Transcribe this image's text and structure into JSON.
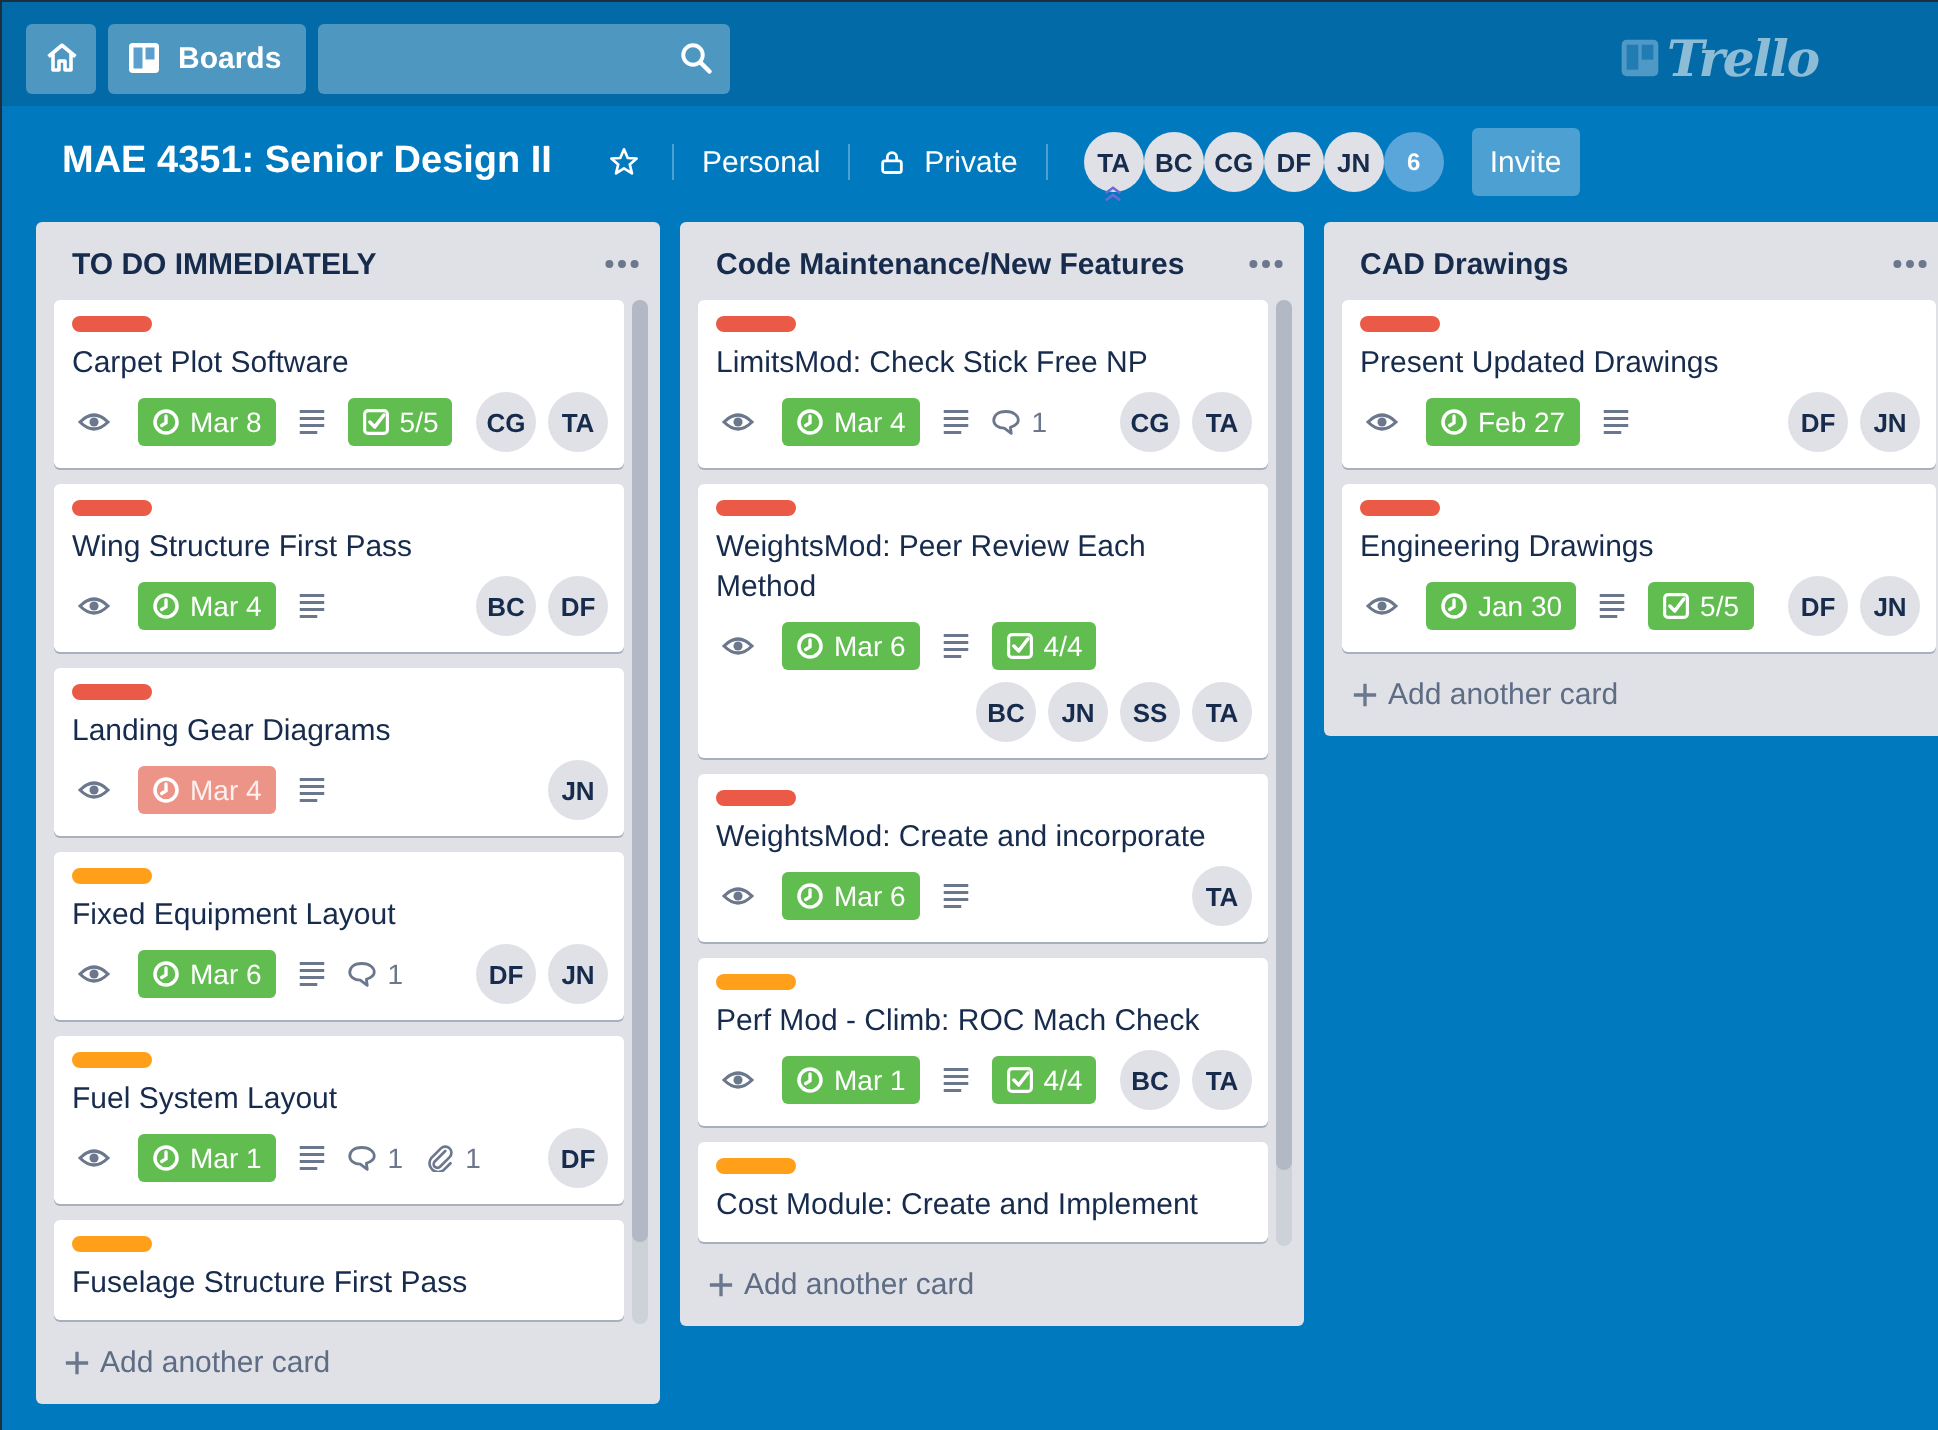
{
  "header": {
    "boards_button": "Boards",
    "logo_text": "Trello"
  },
  "board": {
    "title": "MAE 4351: Senior Design II",
    "starred": false,
    "team": "Personal",
    "visibility": "Private",
    "members": [
      {
        "initials": "TA",
        "admin": true
      },
      {
        "initials": "BC",
        "admin": false
      },
      {
        "initials": "CG",
        "admin": false
      },
      {
        "initials": "DF",
        "admin": false
      },
      {
        "initials": "JN",
        "admin": false
      }
    ],
    "more_members": "6",
    "invite_button": "Invite"
  },
  "lists": [
    {
      "title": "TO DO IMMEDIATELY",
      "scrollbar": true,
      "add_card": "Add another card",
      "cards": [
        {
          "label": {
            "color": "#eb5a46"
          },
          "title": "Carpet Plot Software",
          "watching": true,
          "due": {
            "text": "Mar 8",
            "overdue": false
          },
          "description": true,
          "checklist": {
            "text": "5/5",
            "complete": true
          },
          "members": [
            "CG",
            "TA"
          ]
        },
        {
          "label": {
            "color": "#eb5a46"
          },
          "title": "Wing Structure First Pass",
          "watching": true,
          "due": {
            "text": "Mar 4",
            "overdue": false
          },
          "description": true,
          "members": [
            "BC",
            "DF"
          ]
        },
        {
          "label": {
            "color": "#eb5a46"
          },
          "title": "Landing Gear Diagrams",
          "watching": true,
          "due": {
            "text": "Mar 4",
            "overdue": true
          },
          "description": true,
          "members": [
            "JN"
          ]
        },
        {
          "label": {
            "color": "#ff9f1a"
          },
          "title": "Fixed Equipment Layout",
          "watching": true,
          "due": {
            "text": "Mar 6",
            "overdue": false
          },
          "description": true,
          "comments": "1",
          "members": [
            "DF",
            "JN"
          ]
        },
        {
          "label": {
            "color": "#ff9f1a"
          },
          "title": "Fuel System Layout",
          "watching": true,
          "due": {
            "text": "Mar 1",
            "overdue": false
          },
          "description": true,
          "comments": "1",
          "attachments": "1",
          "members": [
            "DF"
          ]
        },
        {
          "label": {
            "color": "#ff9f1a"
          },
          "title": "Fuselage Structure First Pass"
        }
      ]
    },
    {
      "title": "Code Maintenance/New Features",
      "scrollbar": true,
      "add_card": "Add another card",
      "cards": [
        {
          "label": {
            "color": "#eb5a46"
          },
          "title": "LimitsMod: Check Stick Free NP",
          "watching": true,
          "due": {
            "text": "Mar 4",
            "overdue": false
          },
          "description": true,
          "comments": "1",
          "members": [
            "CG",
            "TA"
          ]
        },
        {
          "label": {
            "color": "#eb5a46"
          },
          "title": "WeightsMod: Peer Review Each Method",
          "watching": true,
          "due": {
            "text": "Mar 6",
            "overdue": false
          },
          "description": true,
          "checklist": {
            "text": "4/4",
            "complete": true
          },
          "members": [
            "BC",
            "JN",
            "SS",
            "TA"
          ]
        },
        {
          "label": {
            "color": "#eb5a46"
          },
          "title": "WeightsMod: Create and incorporate",
          "watching": true,
          "due": {
            "text": "Mar 6",
            "overdue": false
          },
          "description": true,
          "members": [
            "TA"
          ]
        },
        {
          "label": {
            "color": "#ff9f1a"
          },
          "title": "Perf Mod - Climb: ROC Mach Check",
          "watching": true,
          "due": {
            "text": "Mar 1",
            "overdue": false
          },
          "description": true,
          "checklist": {
            "text": "4/4",
            "complete": true
          },
          "members": [
            "BC",
            "TA"
          ]
        },
        {
          "label": {
            "color": "#ff9f1a"
          },
          "title": "Cost Module: Create and Implement"
        }
      ]
    },
    {
      "title": "CAD Drawings",
      "scrollbar": false,
      "add_card": "Add another card",
      "cards": [
        {
          "label": {
            "color": "#eb5a46"
          },
          "title": "Present Updated Drawings",
          "watching": true,
          "due": {
            "text": "Feb 27",
            "overdue": false
          },
          "description": true,
          "members": [
            "DF",
            "JN"
          ]
        },
        {
          "label": {
            "color": "#eb5a46"
          },
          "title": "Engineering Drawings",
          "watching": true,
          "due": {
            "text": "Jan 30",
            "overdue": false
          },
          "description": true,
          "checklist": {
            "text": "5/5",
            "complete": true
          },
          "members": [
            "DF",
            "JN"
          ]
        }
      ]
    }
  ]
}
